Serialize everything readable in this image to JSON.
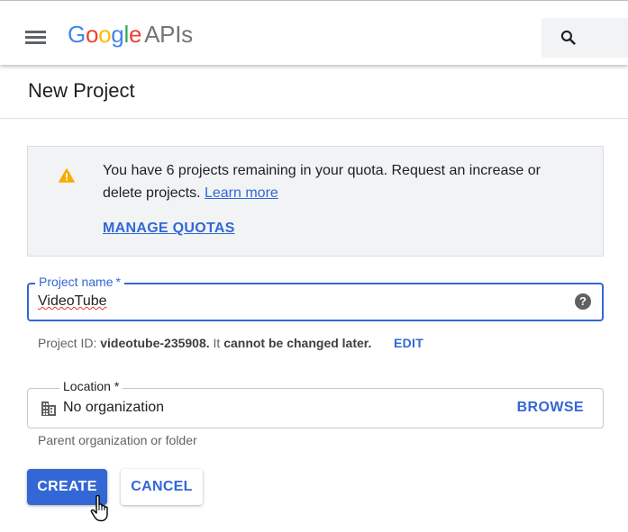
{
  "header": {
    "logo_letters": [
      "G",
      "o",
      "o",
      "g",
      "l",
      "e"
    ],
    "logo_suffix": "APIs",
    "icons": {
      "menu": "hamburger-menu-icon",
      "search": "search-icon"
    }
  },
  "page": {
    "title": "New Project"
  },
  "quota_notice": {
    "icon": "warning-icon",
    "message": "You have 6 projects remaining in your quota. Request an increase or delete projects.",
    "learn_more": "Learn more",
    "manage_quotas": "MANAGE QUOTAS"
  },
  "project_name": {
    "label": "Project name",
    "required_mark": "*",
    "value": "VideoTube",
    "help_icon": "help-icon",
    "help_glyph": "?"
  },
  "project_id": {
    "prefix": "Project ID:",
    "id": "videotube-235908.",
    "middle": "It",
    "emphasis": "cannot be changed later.",
    "edit_label": "EDIT"
  },
  "location": {
    "label": "Location *",
    "icon": "building-icon",
    "value": "No organization",
    "browse_label": "BROWSE",
    "helper": "Parent organization or folder"
  },
  "actions": {
    "create_label": "CREATE",
    "cancel_label": "CANCEL"
  },
  "colors": {
    "accent": "#3367d6",
    "warning": "#f9ab00",
    "notice_background": "#f1f3f4"
  }
}
